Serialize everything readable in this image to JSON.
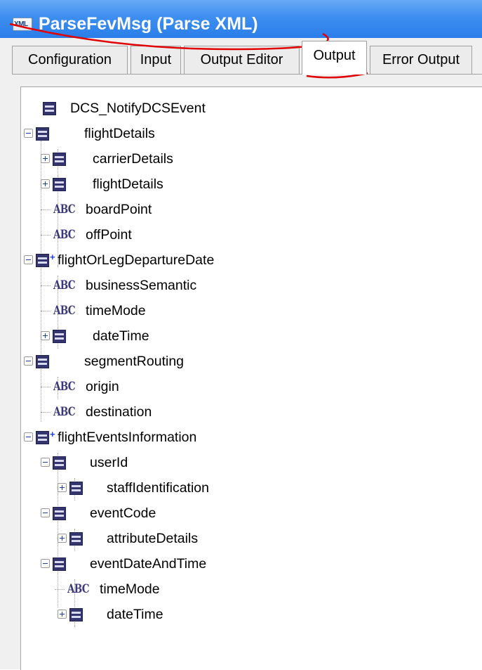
{
  "window": {
    "title": "ParseFevMsg (Parse XML)",
    "title_icon_text": "XML"
  },
  "tabs": [
    {
      "label": "Configuration",
      "active": false
    },
    {
      "label": "Input",
      "active": false
    },
    {
      "label": "Output Editor",
      "active": false
    },
    {
      "label": "Output",
      "active": true
    },
    {
      "label": "Error Output",
      "active": false
    }
  ],
  "tree": [
    {
      "label": "DCS_NotifyDCSEvent",
      "icon": "structure-icon"
    },
    {
      "label": "flightDetails",
      "icon": "structure-icon",
      "expander": "expanded"
    },
    {
      "label": "carrierDetails",
      "icon": "structure-icon",
      "expander": "collapsed"
    },
    {
      "label": "flightDetails",
      "icon": "structure-icon",
      "expander": "collapsed"
    },
    {
      "label": "boardPoint",
      "icon": "string-icon"
    },
    {
      "label": "offPoint",
      "icon": "string-icon"
    },
    {
      "label": "flightOrLegDepartureDate",
      "icon": "structure-list-icon",
      "expander": "expanded"
    },
    {
      "label": "businessSemantic",
      "icon": "string-icon"
    },
    {
      "label": "timeMode",
      "icon": "string-icon"
    },
    {
      "label": "dateTime",
      "icon": "structure-icon",
      "expander": "collapsed"
    },
    {
      "label": "segmentRouting",
      "icon": "structure-icon",
      "expander": "expanded"
    },
    {
      "label": "origin",
      "icon": "string-icon"
    },
    {
      "label": "destination",
      "icon": "string-icon"
    },
    {
      "label": "flightEventsInformation",
      "icon": "structure-list-icon",
      "expander": "expanded"
    },
    {
      "label": "userId",
      "icon": "structure-icon",
      "expander": "expanded"
    },
    {
      "label": "staffIdentification",
      "icon": "structure-icon",
      "expander": "collapsed"
    },
    {
      "label": "eventCode",
      "icon": "structure-icon",
      "expander": "expanded"
    },
    {
      "label": "attributeDetails",
      "icon": "structure-icon",
      "expander": "collapsed"
    },
    {
      "label": "eventDateAndTime",
      "icon": "structure-icon",
      "expander": "expanded"
    },
    {
      "label": "timeMode",
      "icon": "string-icon"
    },
    {
      "label": "dateTime",
      "icon": "structure-icon",
      "expander": "collapsed"
    }
  ],
  "string_icon_glyph": "ABC",
  "list_marker_glyph": "+",
  "colors": {
    "title_bar": "#3d8ef0",
    "title_text": "#ffffff",
    "annotation": "#e00000",
    "structure_icon": "#35356e"
  }
}
